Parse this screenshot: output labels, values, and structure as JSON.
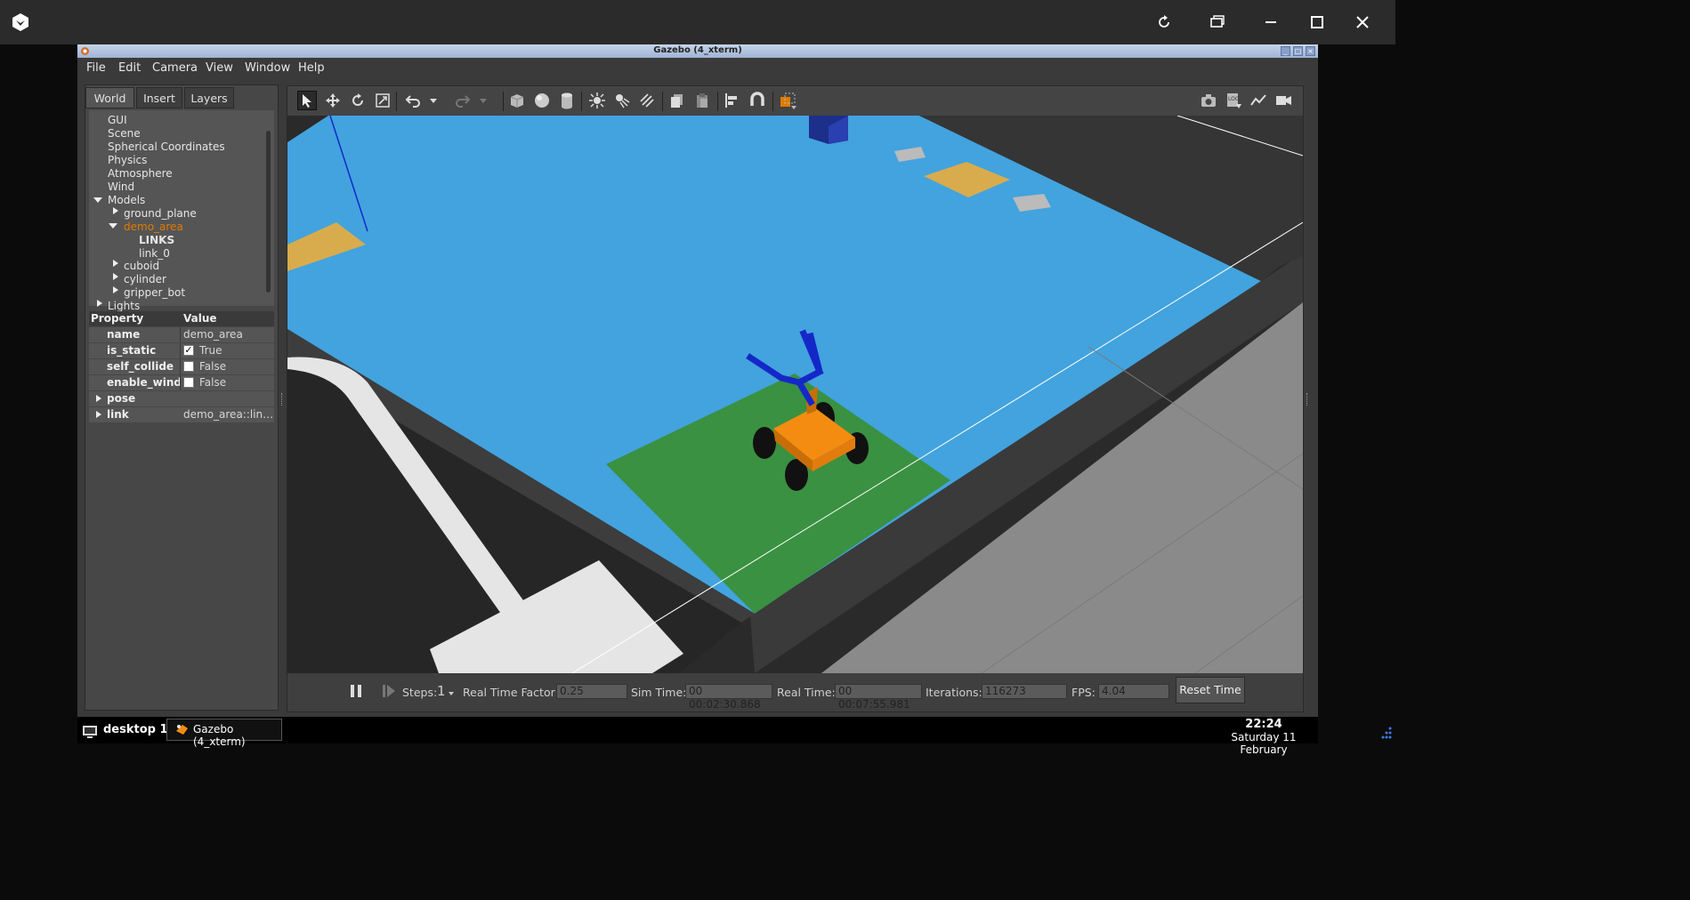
{
  "host": {
    "icons": [
      "app-logo-icon",
      "refresh-icon",
      "restore-windows-icon",
      "minimize-icon",
      "maximize-icon",
      "close-icon"
    ]
  },
  "window": {
    "title": "Gazebo (4_xterm)",
    "controls": [
      "_",
      "□",
      "×"
    ]
  },
  "menu": [
    "File",
    "Edit",
    "Camera",
    "View",
    "Window",
    "Help"
  ],
  "left_panel": {
    "tabs": [
      "World",
      "Insert",
      "Layers"
    ],
    "tree": {
      "gui": "GUI",
      "scene": "Scene",
      "spherical": "Spherical Coordinates",
      "physics": "Physics",
      "atmosphere": "Atmosphere",
      "wind": "Wind",
      "models": "Models",
      "ground_plane": "ground_plane",
      "demo_area": "demo_area",
      "links": "LINKS",
      "link_0": "link_0",
      "cuboid": "cuboid",
      "cylinder": "cylinder",
      "gripper_bot": "gripper_bot",
      "lights": "Lights"
    },
    "properties": {
      "header_property": "Property",
      "header_value": "Value",
      "rows": [
        {
          "key": "name",
          "value": "demo_area"
        },
        {
          "key": "is_static",
          "value": "True",
          "checked": true
        },
        {
          "key": "self_collide",
          "value": "False",
          "checked": false
        },
        {
          "key": "enable_wind",
          "value": "False",
          "checked": false
        },
        {
          "key": "pose",
          "value": ""
        },
        {
          "key": "link",
          "value": "demo_area::lin…"
        }
      ]
    }
  },
  "toolbar_icons": [
    "select-arrow-icon",
    "translate-icon",
    "rotate-icon",
    "scale-icon",
    "undo-icon",
    "redo-icon",
    "box-shape-icon",
    "sphere-shape-icon",
    "cylinder-shape-icon",
    "point-light-icon",
    "spot-light-icon",
    "directional-light-icon",
    "copy-icon",
    "paste-icon",
    "align-icon",
    "snap-icon",
    "view-angle-icon",
    "screenshot-icon",
    "log-icon",
    "plot-icon",
    "video-icon"
  ],
  "bottom": {
    "steps_label": "Steps:",
    "steps_value": "1",
    "rtf_label": "Real Time Factor:",
    "rtf_value": "0.25",
    "sim_label": "Sim Time:",
    "sim_value": "00 00:02:30.868",
    "real_label": "Real Time:",
    "real_value": "00 00:07:55.981",
    "iter_label": "Iterations:",
    "iter_value": "116273",
    "fps_label": "FPS:",
    "fps_value": "4.04",
    "reset_label": "Reset Time"
  },
  "taskbar": {
    "desktop_label": "desktop 1",
    "task_label": "Gazebo (4_xterm)",
    "time": "22:24",
    "date": "Saturday 11 February"
  },
  "colors": {
    "arena_blue": "#42a3de",
    "start_green": "#3a9141",
    "robot_orange": "#f48c12",
    "arm_blue": "#1428c8",
    "marker_yellow": "#d8ac4c",
    "selection_orange": "#e07b00"
  }
}
